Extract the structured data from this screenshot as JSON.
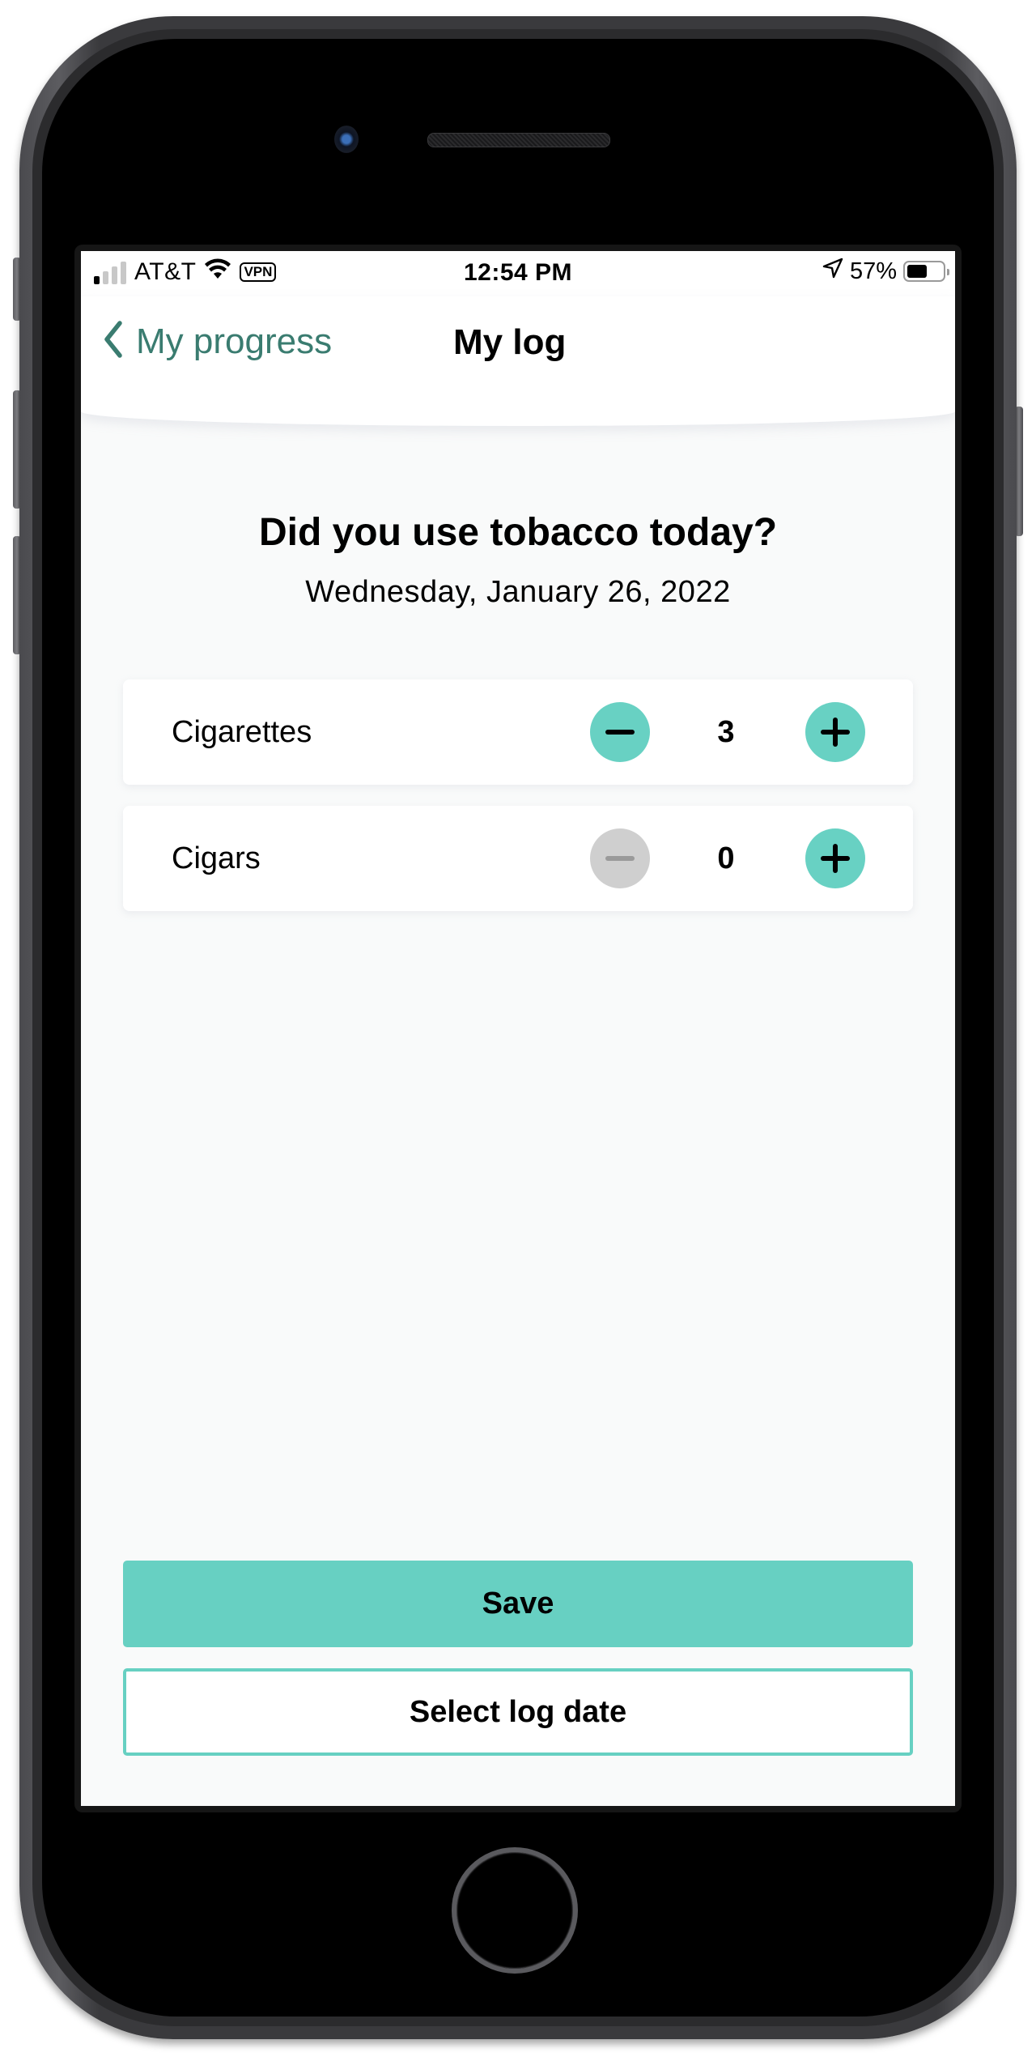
{
  "device": {
    "frame_color": "#3a3a3d"
  },
  "status_bar": {
    "carrier": "AT&T",
    "signal_bars_active": 1,
    "signal_bars_total": 4,
    "wifi_icon": "wifi-icon",
    "vpn_label": "VPN",
    "time": "12:54 PM",
    "location_icon": "location-arrow-icon",
    "battery_percent_label": "57%",
    "battery_level": 0.57
  },
  "navbar": {
    "back_label": "My progress",
    "back_icon": "chevron-left-icon",
    "title": "My log",
    "accent_color": "#3a7c70"
  },
  "main": {
    "question": "Did you use tobacco today?",
    "date": "Wednesday, January 26, 2022",
    "items": [
      {
        "label": "Cigarettes",
        "count": "3",
        "decrement_enabled": true,
        "increment_enabled": true
      },
      {
        "label": "Cigars",
        "count": "0",
        "decrement_enabled": false,
        "increment_enabled": true
      }
    ]
  },
  "actions": {
    "save_label": "Save",
    "select_date_label": "Select log date",
    "primary_color": "#67d0c2"
  }
}
